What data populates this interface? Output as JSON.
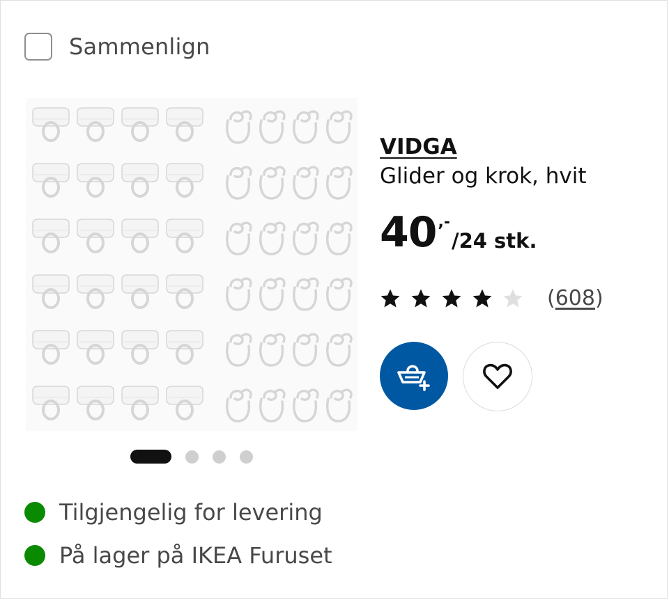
{
  "compare": {
    "label": "Sammenlign",
    "checked": false
  },
  "product": {
    "name": "VIDGA",
    "description": "Glider og krok, hvit",
    "price": {
      "integer": "40",
      "decimal": ",-",
      "unit": "/24 stk."
    },
    "rating": {
      "value": 4,
      "max": 5,
      "reviews_label": "(608)",
      "reviews_count": "608"
    },
    "image_icon": "curtain-glider-and-hook-product-photo"
  },
  "carousel": {
    "total": 4,
    "active_index": 0
  },
  "actions": {
    "cart_icon": "add-to-cart-icon",
    "favourite_icon": "heart-icon"
  },
  "availability": [
    {
      "text": "Tilgjengelig for levering",
      "status_color": "#0a8a00"
    },
    {
      "text": "På lager på IKEA Furuset",
      "status_color": "#0a8a00"
    }
  ],
  "colors": {
    "brand_blue": "#0058a3",
    "status_green": "#0a8a00",
    "star_filled": "#111111",
    "star_empty": "#dfdfdf"
  }
}
